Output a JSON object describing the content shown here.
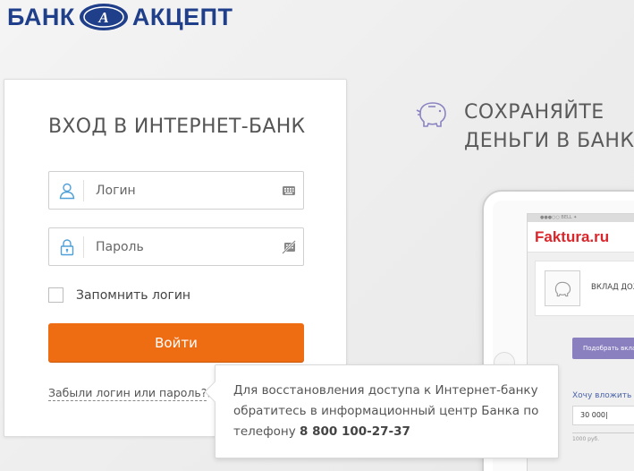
{
  "logo": {
    "left": "БАНК",
    "right": "АКЦЕПТ",
    "emblem_letter": "А",
    "color": "#203f8a"
  },
  "login_form": {
    "title": "ВХОД В ИНТЕРНЕТ-БАНК",
    "login_placeholder": "Логин",
    "login_value": "",
    "password_placeholder": "Пароль",
    "password_value": "",
    "remember_label": "Запомнить логин",
    "remember_checked": false,
    "submit_label": "Войти",
    "forgot_link": "Забыли логин или пароль?",
    "icons": {
      "login": "user-icon",
      "password": "lock-icon",
      "keyboard": "keyboard-icon",
      "visibility": "eye-hidden-icon"
    },
    "accent_color": "#ef6d12",
    "icon_color": "#4fa0d8"
  },
  "tooltip": {
    "text": "Для восстановления доступа к Интернет-банку обратитесь в информационный центр Банка по телефону ",
    "phone": "8 800 100-27-37"
  },
  "promo": {
    "line1": "СОХРАНЯЙТЕ",
    "line2": "ДЕНЬГИ В БАНКЕ",
    "icon": "piggy-bank-icon"
  },
  "tablet": {
    "statusbar": "●●●○○ BELL  ✦",
    "brand": "Faktura.ru",
    "deposit_label": "ВКЛАД ДОХ",
    "pick_button": "Подобрать вклад",
    "invest_label": "Хочу вложить",
    "invest_value": "30 000|",
    "slider_min": "1000 руб."
  }
}
